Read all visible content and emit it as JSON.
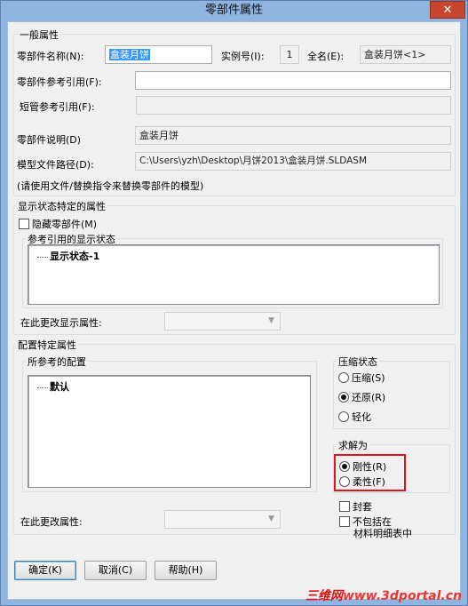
{
  "window": {
    "title": "零部件属性",
    "close_glyph": "✕"
  },
  "general": {
    "legend": "一般属性",
    "component_name_label": "零部件名称(N):",
    "component_name_value": "盒装月饼",
    "instance_label": "实例号(I):",
    "instance_value": "1",
    "fullname_label": "全名(E):",
    "fullname_value": "盒装月饼<1>",
    "ref_label": "零部件参考引用(F):",
    "ref_value": "",
    "short_ref_label": "短管参考引用(F):",
    "short_ref_value": "",
    "desc_label": "零部件说明(D)",
    "desc_value": "盒装月饼",
    "path_label": "模型文件路径(D):",
    "path_value": "C:\\Users\\yzh\\Desktop\\月饼2013\\盒装月饼.SLDASM",
    "hint": "(请使用文件/替换指令来替换零部件的模型)"
  },
  "display": {
    "legend": "显示状态特定的属性",
    "hide_label": "隐藏零部件(M)",
    "ref_display_legend": "参考引用的显示状态",
    "display_items": [
      "显示状态-1"
    ],
    "change_label": "在此更改显示属性:",
    "change_value": ""
  },
  "config": {
    "legend": "配置特定属性",
    "ref_config_legend": "所参考的配置",
    "config_items": [
      "默认"
    ],
    "change_label": "在此更改属性:",
    "change_value": "",
    "suppress_legend": "压缩状态",
    "suppress_options": [
      {
        "label": "压缩(S)",
        "selected": false
      },
      {
        "label": "还原(R)",
        "selected": true
      },
      {
        "label": "轻化",
        "selected": false
      }
    ],
    "solve_legend": "求解为",
    "solve_options": [
      {
        "label": "刚性(R)",
        "selected": true
      },
      {
        "label": "柔性(F)",
        "selected": false
      }
    ],
    "envelope_label": "封套",
    "exclude_bom_label_line1": "不包括在",
    "exclude_bom_label_line2": "材料明细表中"
  },
  "buttons": {
    "ok": "确定(K)",
    "cancel": "取消(C)",
    "help": "帮助(H)"
  },
  "watermark": {
    "cn": "三维网",
    "url": "www.3dportal.cn"
  },
  "colors": {
    "title_bar": "#8fb4df",
    "close_button": "#c7462f",
    "highlight": "#e0141e",
    "selection": "#3399ff"
  }
}
